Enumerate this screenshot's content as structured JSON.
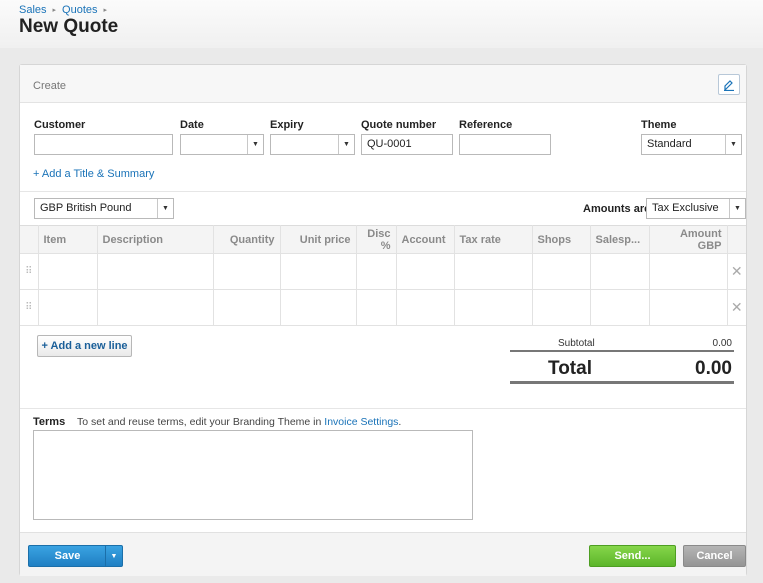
{
  "breadcrumb": {
    "items": [
      "Sales",
      "Quotes"
    ],
    "sep": "▸"
  },
  "page": {
    "title": "New Quote"
  },
  "card": {
    "create_label": "Create"
  },
  "form": {
    "customer": {
      "label": "Customer",
      "value": ""
    },
    "date": {
      "label": "Date",
      "value": ""
    },
    "expiry": {
      "label": "Expiry",
      "value": ""
    },
    "quote_number": {
      "label": "Quote number",
      "value": "QU-0001"
    },
    "reference": {
      "label": "Reference",
      "value": ""
    },
    "theme": {
      "label": "Theme",
      "value": "Standard"
    },
    "add_title_link": "+ Add a Title & Summary",
    "currency": "GBP British Pound",
    "amounts_are": {
      "label": "Amounts are",
      "value": "Tax Exclusive"
    }
  },
  "table": {
    "headers": [
      "Item",
      "Description",
      "Quantity",
      "Unit price",
      "Disc %",
      "Account",
      "Tax rate",
      "Shops",
      "Salesp...",
      "Amount GBP"
    ],
    "grip": "⠿",
    "delete": "✕"
  },
  "actions": {
    "add_line": "+ Add a new line"
  },
  "totals": {
    "subtotal_label": "Subtotal",
    "subtotal_value": "0.00",
    "total_label": "Total",
    "total_value": "0.00"
  },
  "terms": {
    "label": "Terms",
    "hint_prefix": "To set and reuse terms, edit your Branding Theme in ",
    "hint_link": "Invoice Settings",
    "hint_suffix": "."
  },
  "footer": {
    "save": "Save",
    "send": "Send...",
    "cancel": "Cancel"
  },
  "colors": {
    "link": "#1a73b8",
    "save": "#2a8fd2",
    "send": "#6cc33a",
    "cancel": "#a5a5a5"
  }
}
